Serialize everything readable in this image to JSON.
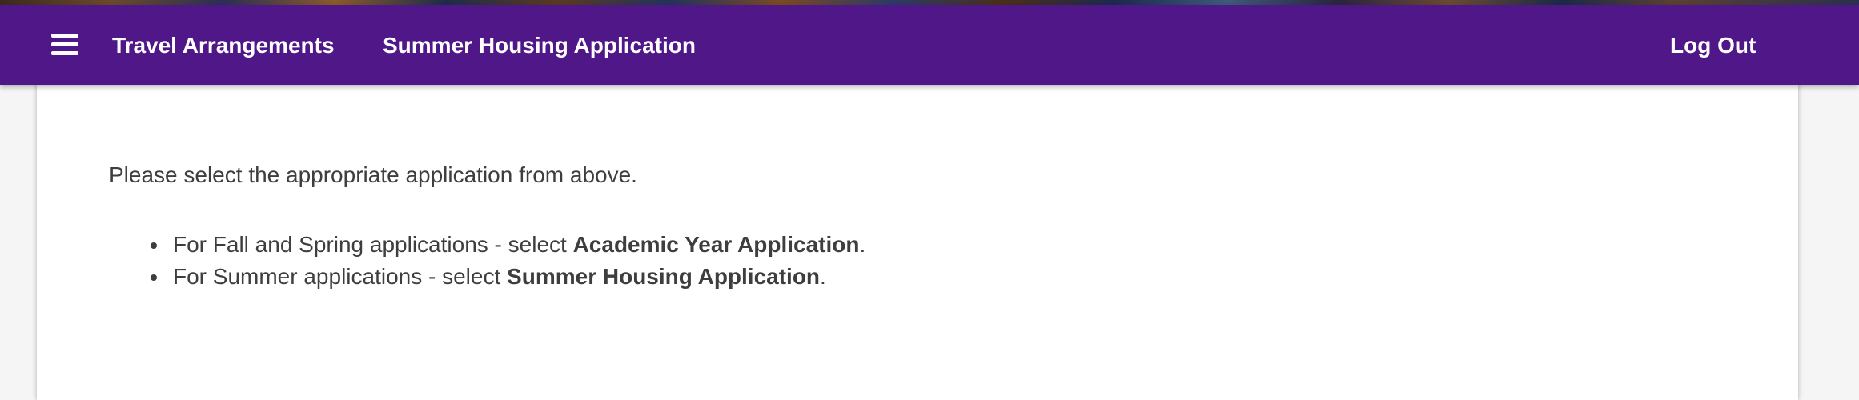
{
  "header": {
    "menu_icon": "hamburger-menu-icon",
    "nav": {
      "travel_label": "Travel Arrangements",
      "summer_label": "Summer Housing Application",
      "logout_label": "Log Out"
    },
    "colors": {
      "navbar_background": "#4f1787",
      "navbar_text": "#ffffff"
    }
  },
  "main": {
    "intro": "Please select the appropriate application from above.",
    "instructions": [
      {
        "prefix": "For Fall and Spring applications - select ",
        "emphasis": "Academic Year Application",
        "suffix": "."
      },
      {
        "prefix": "For Summer applications - select ",
        "emphasis": "Summer Housing Application",
        "suffix": "."
      }
    ]
  }
}
